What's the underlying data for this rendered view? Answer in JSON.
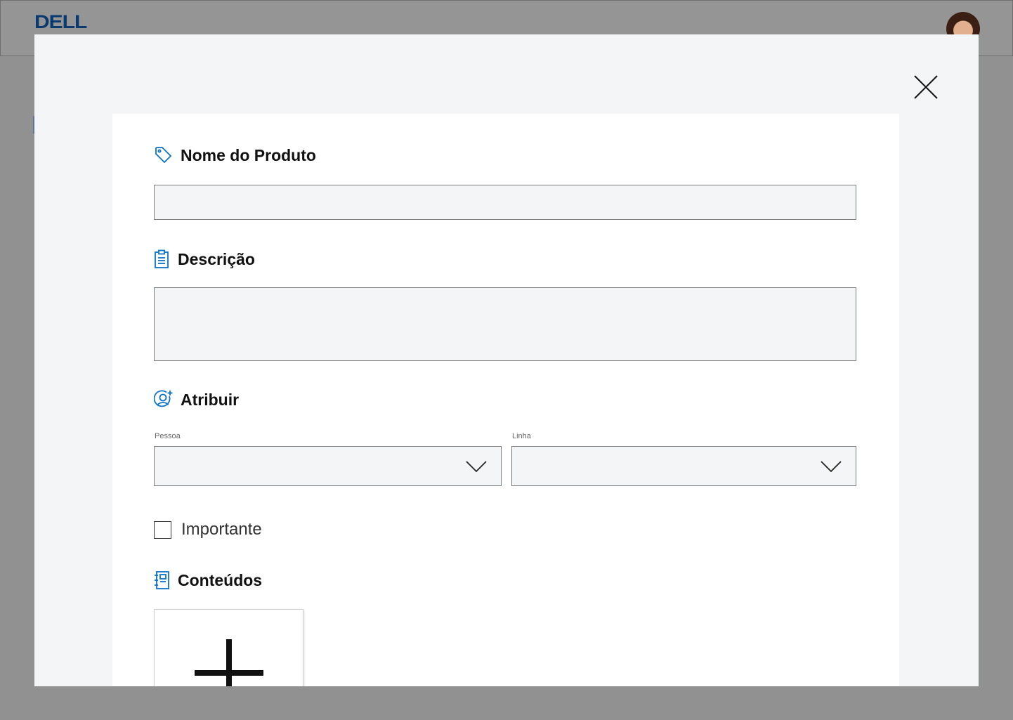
{
  "header": {
    "logo_text": "DELL",
    "avatar": "user-avatar"
  },
  "modal": {
    "close_icon": "close-icon",
    "sections": {
      "product_name": {
        "title": "Nome do Produto",
        "icon": "tag-icon",
        "value": ""
      },
      "description": {
        "title": "Descrição",
        "icon": "clipboard-icon",
        "value": ""
      },
      "assign": {
        "title": "Atribuir",
        "icon": "add-user-icon",
        "person": {
          "label": "Pessoa",
          "value": ""
        },
        "line": {
          "label": "Linha",
          "value": ""
        }
      },
      "important": {
        "label": "Importante",
        "checked": false
      },
      "contents": {
        "title": "Conteúdos",
        "icon": "notebook-icon",
        "add_icon": "plus-icon"
      }
    }
  },
  "colors": {
    "overlay": "#919191",
    "modal_bg": "#f4f5f6",
    "card_bg": "#ffffff",
    "accent": "#0b72c9",
    "brand": "#0b3a6e"
  }
}
